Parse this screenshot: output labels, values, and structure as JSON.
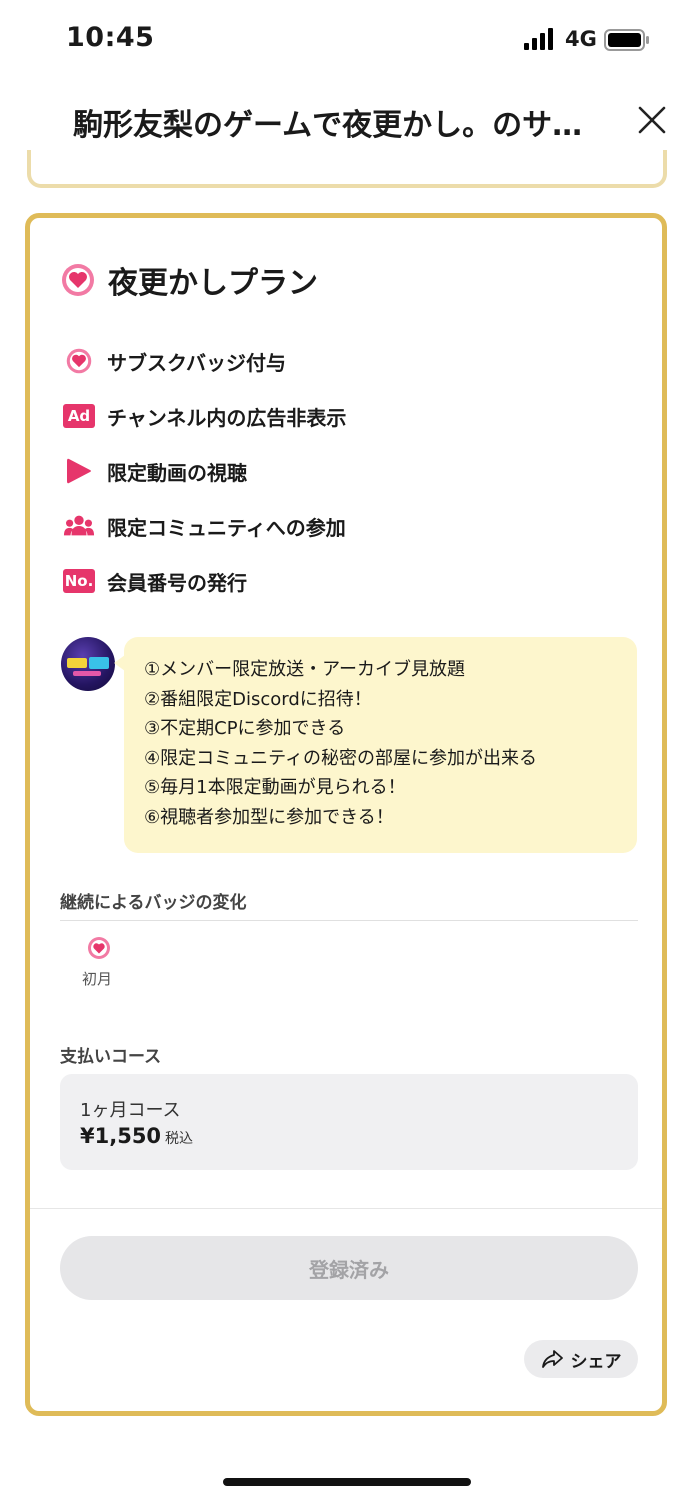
{
  "status_bar": {
    "time": "10:45",
    "network": "4G"
  },
  "header": {
    "title": "駒形友梨のゲームで夜更かし。のサ…",
    "close_icon": "close-icon"
  },
  "plan": {
    "title": "夜更かしプラン",
    "accent_color": "#e6356b",
    "benefits": [
      {
        "icon": "heart-badge-icon",
        "label": "サブスクバッジ付与"
      },
      {
        "icon": "ad-icon",
        "icon_text": "Ad",
        "label": "チャンネル内の広告非表示"
      },
      {
        "icon": "play-icon",
        "label": "限定動画の視聴"
      },
      {
        "icon": "community-icon",
        "label": "限定コミュニティへの参加"
      },
      {
        "icon": "member-number-icon",
        "icon_text": "No.",
        "label": "会員番号の発行"
      }
    ],
    "message_lines": [
      "①メンバー限定放送・アーカイブ見放題",
      "②番組限定Discordに招待！",
      "③不定期CPに参加できる",
      "④限定コミュニティの秘密の部屋に参加が出来る",
      "⑤毎月1本限定動画が見られる！",
      "⑥視聴者参加型に参加できる！"
    ],
    "badge_section_label": "継続によるバッジの変化",
    "badge_months": [
      {
        "label": "初月"
      }
    ],
    "payment_section_label": "支払いコース",
    "course": {
      "name": "1ヶ月コース",
      "price": "¥1,550",
      "tax_note": "税込"
    },
    "registered_button": "登録済み",
    "share_button": "シェア"
  }
}
